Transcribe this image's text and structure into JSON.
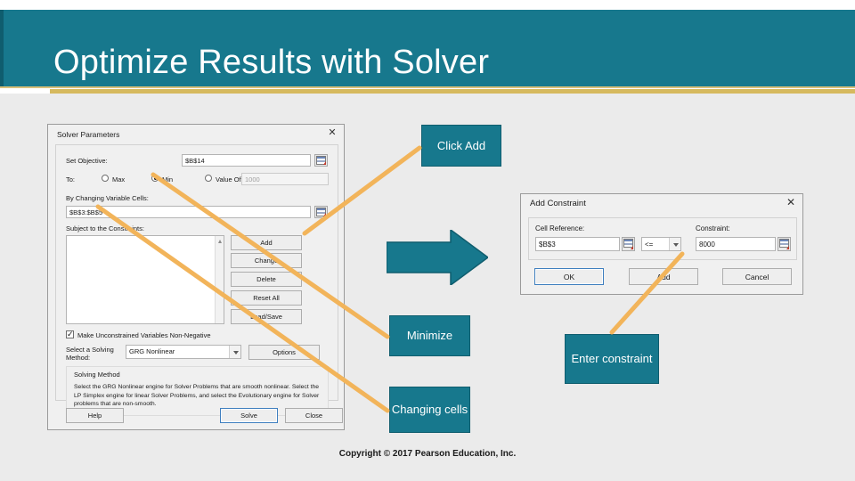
{
  "slide": {
    "title": "Optimize Results with Solver",
    "copyright": "Copyright © 2017 Pearson Education, Inc.",
    "accent_teal": "#17788D",
    "accent_gold": "#d6b95e",
    "connector_orange": "#f2b45a"
  },
  "solver_dialog": {
    "title": "Solver Parameters",
    "close_label": "✕",
    "set_objective_label": "Set Objective:",
    "set_objective_value": "$B$14",
    "to_label": "To:",
    "radio_max": "Max",
    "radio_min": "Min",
    "radio_value_of": "Value Of:",
    "selected_option": "Min",
    "value_of_input": "1000",
    "changing_cells_label": "By Changing Variable Cells:",
    "changing_cells_value": "$B$3:$B$5",
    "constraints_label": "Subject to the Constraints:",
    "constraints_items": [],
    "side_buttons": [
      "Add",
      "Change",
      "Delete",
      "Reset All",
      "Load/Save"
    ],
    "nonnegative_label": "Make Unconstrained Variables Non-Negative",
    "nonnegative_checked": true,
    "solving_method_label": "Select a Solving Method:",
    "solving_method_value": "GRG Nonlinear",
    "options_button": "Options",
    "method_group_title": "Solving Method",
    "method_group_body": "Select the GRG Nonlinear engine for Solver Problems that are smooth nonlinear. Select the LP Simplex engine for linear Solver Problems, and select the Evolutionary engine for Solver problems that are non-smooth.",
    "help_button": "Help",
    "solve_button": "Solve",
    "close_button": "Close"
  },
  "constraint_dialog": {
    "title": "Add Constraint",
    "close_label": "✕",
    "cell_reference_label": "Cell Reference:",
    "cell_reference_value": "$B$3",
    "operator_value": "<=",
    "constraint_label": "Constraint:",
    "constraint_value": "8000",
    "ok_button": "OK",
    "add_button": "Add",
    "cancel_button": "Cancel"
  },
  "callouts": {
    "click_add": "Click Add",
    "minimize": "Minimize",
    "changing_cells": "Changing cells",
    "enter_constraint": "Enter constraint"
  }
}
